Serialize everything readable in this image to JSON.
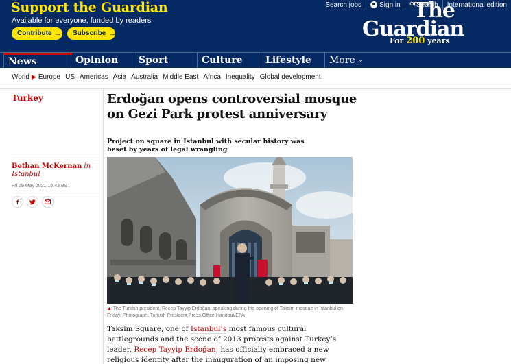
{
  "header": {
    "support_title": "Support the Guardian",
    "support_sub": "Available for everyone, funded by readers",
    "contribute_label": "Contribute",
    "subscribe_label": "Subscribe",
    "arrow": "→",
    "links": {
      "search_jobs": "Search jobs",
      "sign_in": "Sign in",
      "search": "Search",
      "edition": "International edition"
    },
    "logo_the": "The",
    "logo_guardian": "Guardian",
    "logo_for": "For",
    "logo_years_num": "200",
    "logo_years": "years"
  },
  "pillars": [
    "News",
    "Opinion",
    "Sport",
    "Culture",
    "Lifestyle"
  ],
  "more_label": "More",
  "subnav": {
    "world": "World",
    "europe": "Europe",
    "items": [
      "US",
      "Americas",
      "Asia",
      "Australia",
      "Middle East",
      "Africa",
      "Inequality",
      "Global development"
    ]
  },
  "article": {
    "section": "Turkey",
    "headline": "Erdoğan opens controversial mosque on Gezi Park protest anniversary",
    "standfirst": "Project on square in Istanbul with secular history was beset by years of legal wrangling",
    "author": "Bethan McKernan",
    "author_loc": "in Istanbul",
    "date": "Fri 28 May 2021 16.43 BST",
    "caption": "The Turkish president, Recep Tayyip Erdoğan, speaking during the opening of Taksim mosque in Istanbul on Friday. Photograph: Turkish President Press Office Handout/EPA",
    "body": {
      "p1_a": "Taksim Square, one of ",
      "link1": "Istanbul’s",
      "p1_b": " most famous cultural battlegrounds and the scene of 2013 protests against Turkey’s leader, ",
      "link2": "Recep Tayyip Erdoğan",
      "p1_c": ", has officially embraced a new religious identity after the inauguration of an imposing new mosque."
    }
  },
  "colors": {
    "brand": "#052962",
    "accent_yellow": "#ffe500",
    "news_red": "#c70000"
  }
}
